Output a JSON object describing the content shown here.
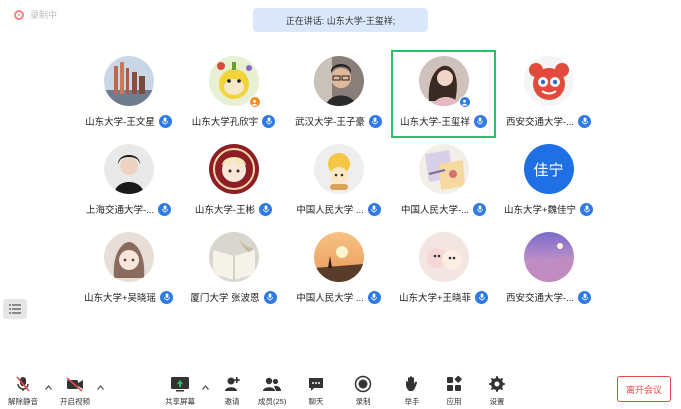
{
  "recording": {
    "label": "录制中"
  },
  "speaking": {
    "text": "正在讲话: 山东大学-王玺祥;"
  },
  "participants": [
    {
      "name": "山东大学-王文星",
      "avatar": "buildings-avatar",
      "badge": "none"
    },
    {
      "name": "山东大学孔欣宇",
      "avatar": "cartoon-avatar",
      "badge": "host"
    },
    {
      "name": "武汉大学-王子豪",
      "avatar": "man-glasses-avatar",
      "badge": "none"
    },
    {
      "name": "山东大学-王玺祥",
      "avatar": "woman-avatar",
      "badge": "cohost"
    },
    {
      "name": "西安交通大学-...",
      "avatar": "red-cartoon-avatar",
      "badge": "none"
    },
    {
      "name": "上海交通大学-...",
      "avatar": "man-avatar",
      "badge": "none"
    },
    {
      "name": "山东大学-王彬",
      "avatar": "anime-seal-avatar",
      "badge": "none"
    },
    {
      "name": "中国人民大学 ...",
      "avatar": "yellow-cartoon-avatar",
      "badge": "none"
    },
    {
      "name": "中国人民大学-...",
      "avatar": "drawing-avatar",
      "badge": "none"
    },
    {
      "name": "山东大学+魏佳宁",
      "avatar": "text-avatar",
      "avatar_text": "佳宁",
      "badge": "none"
    },
    {
      "name": "山东大学+吴晓瑶",
      "avatar": "girl-drawing-avatar",
      "badge": "none"
    },
    {
      "name": "厦门大学  张波恩",
      "avatar": "book-avatar",
      "badge": "none"
    },
    {
      "name": "中国人民大学 ...",
      "avatar": "sunset-avatar",
      "badge": "none"
    },
    {
      "name": "山东大学+王晓菲",
      "avatar": "plush-avatar",
      "badge": "none"
    },
    {
      "name": "西安交通大学-...",
      "avatar": "sky-avatar",
      "badge": "none"
    }
  ],
  "toolbar": {
    "unmute": "解除静音",
    "start_video": "开启视频",
    "share_screen": "共享屏幕",
    "invite": "邀请",
    "members": "成员(25)",
    "chat": "聊天",
    "record": "录制",
    "raise_hand": "举手",
    "apps": "应用",
    "settings": "设置"
  },
  "leave": {
    "label": "离开会议"
  },
  "colors": {
    "accent": "#2f7ae5",
    "active_border": "#2bbf6a",
    "danger": "#e64a4a",
    "speaking_bg": "#dbe8fb"
  }
}
